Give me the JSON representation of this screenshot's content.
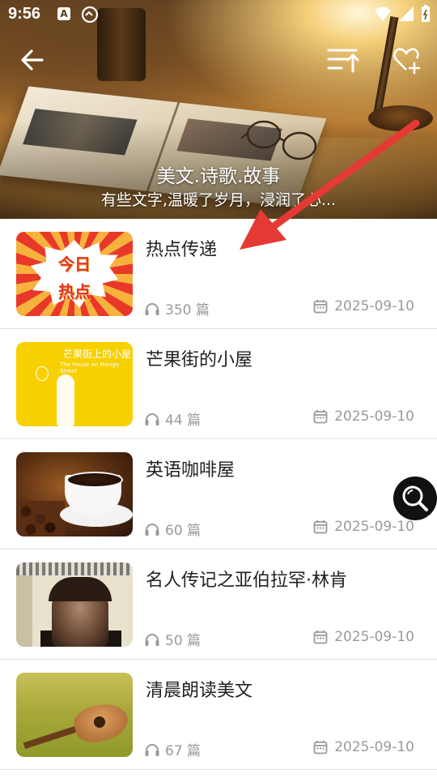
{
  "status_bar": {
    "time": "9:56",
    "indicator_a": "A"
  },
  "header": {
    "title": "美文.诗歌.故事",
    "subtitle": "有些文字,温暖了岁月，浸润了心..."
  },
  "icons": {
    "back": "arrow-left-icon",
    "sort": "sort-icon",
    "favorite": "heart-plus-icon",
    "search": "search-icon",
    "count": "headphones-icon",
    "date": "calendar-icon"
  },
  "colors": {
    "accent_arrow": "#e53935",
    "meta_text": "#9a9a9a",
    "title_text": "#222222",
    "fab": "#111111"
  },
  "thumb_text": {
    "hot_line1": "今日",
    "hot_line2": "热点",
    "mango_title": "芒果街上的小屋",
    "mango_sub": "The house on Mango Street"
  },
  "albums": [
    {
      "title": "热点传递",
      "count": "350 篇",
      "date": "2025-09-10"
    },
    {
      "title": "芒果街的小屋",
      "count": "44 篇",
      "date": "2025-09-10"
    },
    {
      "title": "英语咖啡屋",
      "count": "60 篇",
      "date": "2025-09-10"
    },
    {
      "title": "名人传记之亚伯拉罕·林肯",
      "count": "50 篇",
      "date": "2025-09-10"
    },
    {
      "title": "清晨朗读美文",
      "count": "67 篇",
      "date": "2025-09-10"
    }
  ]
}
